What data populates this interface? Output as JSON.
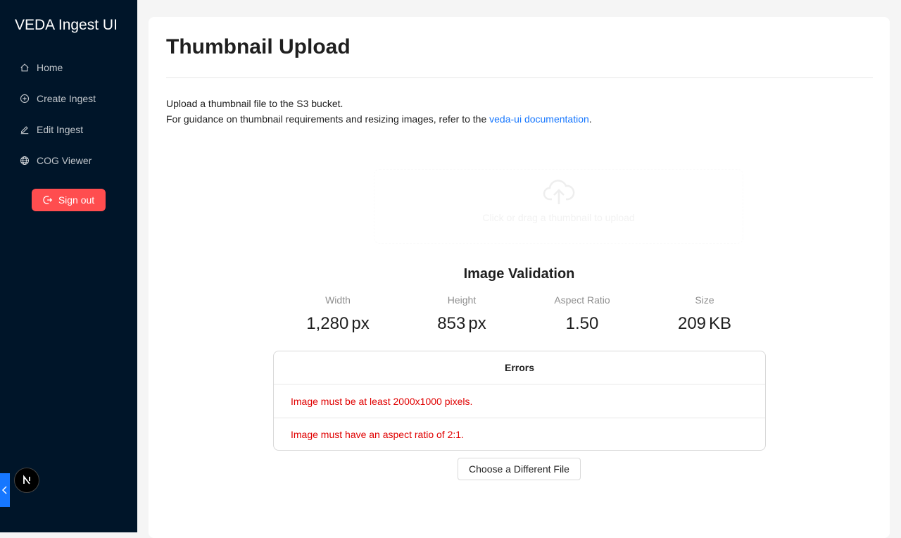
{
  "sidebar": {
    "app_title": "VEDA Ingest UI",
    "items": [
      {
        "label": "Home",
        "icon": "home-icon"
      },
      {
        "label": "Create Ingest",
        "icon": "plus-circle-icon"
      },
      {
        "label": "Edit Ingest",
        "icon": "edit-icon"
      },
      {
        "label": "COG Viewer",
        "icon": "globe-icon"
      }
    ],
    "sign_out_label": "Sign out"
  },
  "page": {
    "title": "Thumbnail Upload",
    "intro_line1": "Upload a thumbnail file to the S3 bucket.",
    "intro_line2_prefix": "For guidance on thumbnail requirements and resizing images, refer to the ",
    "intro_link": "veda-ui documentation",
    "intro_line2_suffix": "."
  },
  "dropzone": {
    "text": "Click or drag a thumbnail to upload"
  },
  "validation": {
    "title": "Image Validation",
    "stats": [
      {
        "label": "Width",
        "value": "1,280",
        "unit": "px"
      },
      {
        "label": "Height",
        "value": "853",
        "unit": "px"
      },
      {
        "label": "Aspect Ratio",
        "value": "1.50",
        "unit": ""
      },
      {
        "label": "Size",
        "value": "209",
        "unit": "KB"
      }
    ]
  },
  "errors": {
    "header": "Errors",
    "items": [
      "Image must be at least 2000x1000 pixels.",
      "Image must have an aspect ratio of 2:1."
    ]
  },
  "choose_button": "Choose a Different File",
  "colors": {
    "sidebar_bg": "#001529",
    "danger": "#ff4d4f",
    "error_text": "#e00000",
    "link": "#1677ff"
  }
}
